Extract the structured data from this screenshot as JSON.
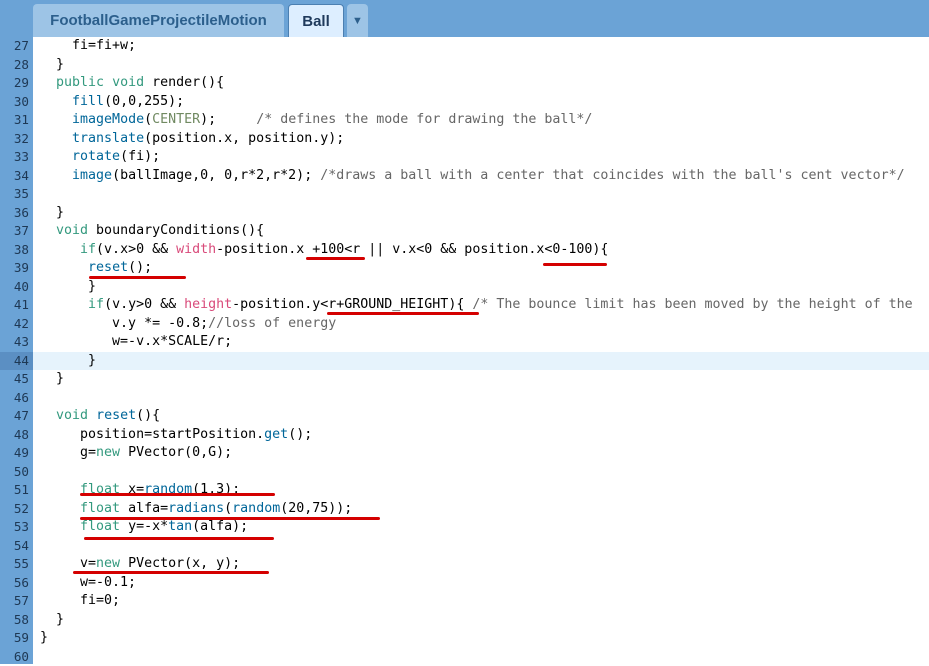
{
  "tabs": [
    {
      "label": "FootballGameProjectileMotion"
    },
    {
      "label": "Ball"
    }
  ],
  "tab_menu_icon": "chevron-down-icon",
  "tab_menu_glyph": "▼",
  "highlight_line": 44,
  "colors": {
    "keyword": "#33997e",
    "func": "#006699",
    "const": "#718a62",
    "comment": "#666666",
    "underline": "#d40000"
  },
  "lines": [
    {
      "n": "27",
      "t": "    fi=fi+w;"
    },
    {
      "n": "28",
      "t": "  }"
    },
    {
      "n": "29",
      "t": "  public void render(){"
    },
    {
      "n": "30",
      "t": "    fill(0,0,255);"
    },
    {
      "n": "31",
      "t": "    imageMode(CENTER);     /* defines the mode for drawing the ball*/"
    },
    {
      "n": "32",
      "t": "    translate(position.x, position.y);"
    },
    {
      "n": "33",
      "t": "    rotate(fi);"
    },
    {
      "n": "34",
      "t": "    image(ballImage,0, 0,r*2,r*2); /*draws a ball with a center that coincides with the ball's cent vector*/"
    },
    {
      "n": "35",
      "t": ""
    },
    {
      "n": "36",
      "t": "  }"
    },
    {
      "n": "37",
      "t": "  void boundaryConditions(){"
    },
    {
      "n": "38",
      "t": "     if(v.x>0 && width-position.x +100<r || v.x<0 && position.x<0-100){"
    },
    {
      "n": "39",
      "t": "      reset();"
    },
    {
      "n": "40",
      "t": "      }"
    },
    {
      "n": "41",
      "t": "      if(v.y>0 && height-position.y<r+GROUND_HEIGHT){ /* The bounce limit has been moved by the height of the"
    },
    {
      "n": "42",
      "t": "         v.y *= -0.8;//loss of energy"
    },
    {
      "n": "43",
      "t": "         w=-v.x*SCALE/r;"
    },
    {
      "n": "44",
      "t": "      }"
    },
    {
      "n": "45",
      "t": "  }"
    },
    {
      "n": "46",
      "t": ""
    },
    {
      "n": "47",
      "t": "  void reset(){"
    },
    {
      "n": "48",
      "t": "     position=startPosition.get();"
    },
    {
      "n": "49",
      "t": "     g=new PVector(0,G);"
    },
    {
      "n": "50",
      "t": ""
    },
    {
      "n": "51",
      "t": "     float x=random(1,3);"
    },
    {
      "n": "52",
      "t": "     float alfa=radians(random(20,75));"
    },
    {
      "n": "53",
      "t": "     float y=-x*tan(alfa);"
    },
    {
      "n": "54",
      "t": ""
    },
    {
      "n": "55",
      "t": "     v=new PVector(x, y);"
    },
    {
      "n": "56",
      "t": "     w=-0.1;"
    },
    {
      "n": "57",
      "t": "     fi=0;"
    },
    {
      "n": "58",
      "t": "  }"
    },
    {
      "n": "59",
      "t": "}"
    },
    {
      "n": "60",
      "t": ""
    }
  ]
}
